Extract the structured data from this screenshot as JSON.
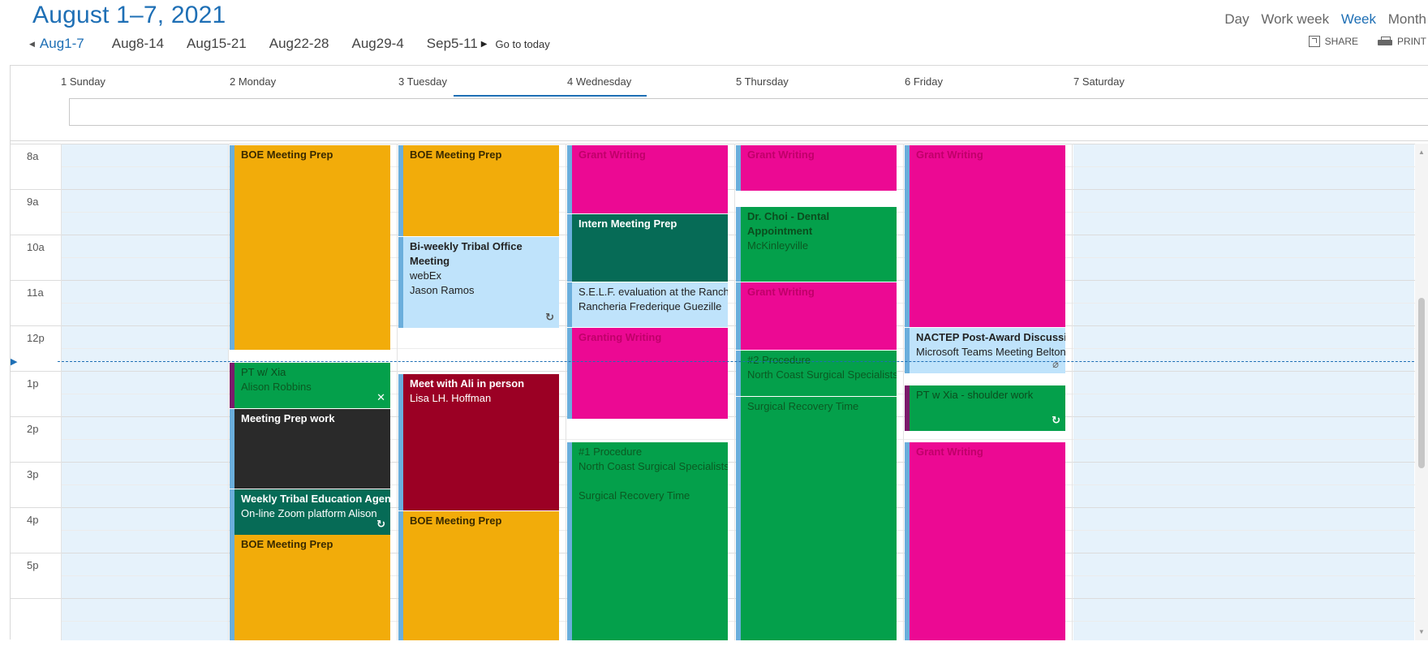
{
  "header": {
    "title": "August 1–7, 2021",
    "weeks": [
      "Aug1-7",
      "Aug8-14",
      "Aug15-21",
      "Aug22-28",
      "Aug29-4",
      "Sep5-11"
    ],
    "goto_today": "Go to today",
    "views": [
      "Day",
      "Work week",
      "Week",
      "Month"
    ],
    "active_view": "Week",
    "share": "SHARE",
    "print": "PRINT"
  },
  "days": [
    "1 Sunday",
    "2 Monday",
    "3 Tuesday",
    "4 Wednesday",
    "5 Thursday",
    "6 Friday",
    "7 Saturday"
  ],
  "hours": [
    "8a",
    "9a",
    "10a",
    "11a",
    "12p",
    "1p",
    "2p",
    "3p",
    "4p",
    "5p"
  ],
  "colors": {
    "orange": "#f2ac0a",
    "pink": "#ec0993",
    "green": "#04a04b",
    "teal": "#066b56",
    "light": "#bfe3fb",
    "dark": "#2a2a2a",
    "wine": "#9b0024",
    "accent": "#1e6fb5"
  },
  "events": {
    "mon": [
      {
        "title": "BOE Meeting Prep"
      },
      {
        "title": "PT w/ Xia",
        "sub": "Alison Robbins"
      },
      {
        "title": "Meeting Prep work"
      },
      {
        "title": "Weekly Tribal Education Agenda",
        "sub": "On-line Zoom platform Alison"
      },
      {
        "title": "BOE Meeting Prep"
      }
    ],
    "tue": [
      {
        "title": "BOE Meeting Prep"
      },
      {
        "title": "Bi-weekly Tribal Office Meeting",
        "sub1": "webEx",
        "sub2": "Jason Ramos"
      },
      {
        "title": "Meet with Ali in person",
        "sub": "Lisa LH. Hoffman"
      },
      {
        "title": "BOE Meeting Prep"
      }
    ],
    "wed": [
      {
        "title": "Grant Writing"
      },
      {
        "title": "Intern Meeting Prep"
      },
      {
        "title": "S.E.L.F. evaluation at the Rancheria",
        "sub": "Rancheria Frederique Guezille"
      },
      {
        "title": "Granting Writing"
      },
      {
        "title": "#1 Procedure",
        "sub": "North Coast Surgical Specialists"
      },
      {
        "title": "Surgical Recovery Time"
      }
    ],
    "thu": [
      {
        "title": "Grant Writing"
      },
      {
        "title": "Dr. Choi - Dental Appointment",
        "sub": "McKinleyville"
      },
      {
        "title": "Grant Writing"
      },
      {
        "title": "#2 Procedure",
        "sub": "North Coast Surgical Specialists"
      },
      {
        "title": "Surgical Recovery Time"
      }
    ],
    "fri": [
      {
        "title": "Grant Writing"
      },
      {
        "title": "NACTEP Post-Award Discussion",
        "sub": "Microsoft Teams Meeting Belton"
      },
      {
        "title": "PT w Xia - shoulder work"
      },
      {
        "title": "Grant Writing"
      }
    ]
  }
}
